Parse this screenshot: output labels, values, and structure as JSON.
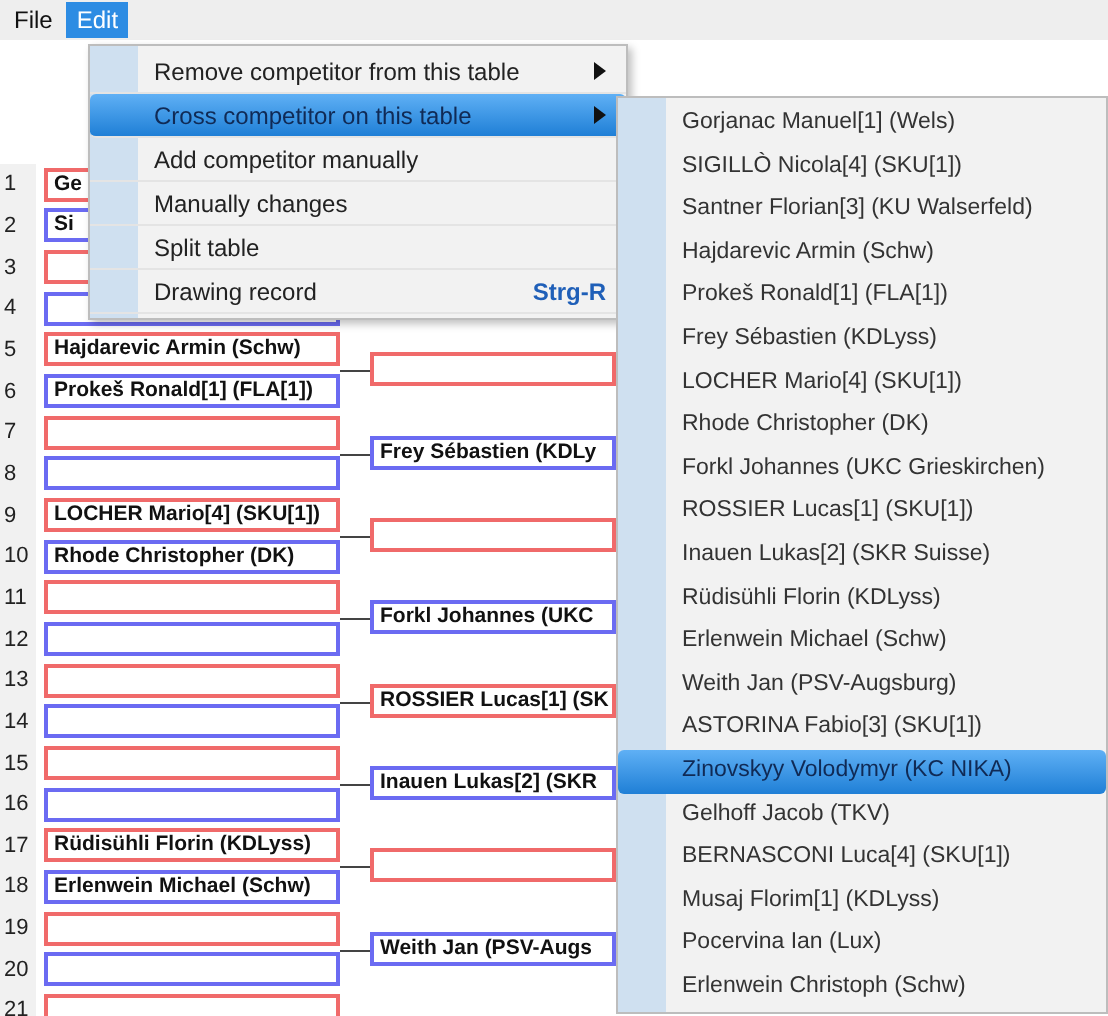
{
  "menu_bar": [
    {
      "label": "File",
      "selected": false
    },
    {
      "label": "Edit",
      "selected": true
    }
  ],
  "bracket": {
    "round_1": [
      {
        "number": "1",
        "name": "Ge"
      },
      {
        "number": "2",
        "name": "Si"
      },
      {
        "number": "3"
      },
      {
        "number": "4"
      },
      {
        "number": "5",
        "name": "Hajdarevic Armin (Schw)"
      },
      {
        "number": "6",
        "name": "Prokeš Ronald[1] (FLA[1])"
      },
      {
        "number": "7"
      },
      {
        "number": "8"
      },
      {
        "number": "9",
        "name": "LOCHER Mario[4] (SKU[1])"
      },
      {
        "number": "10",
        "name": "Rhode Christopher (DK)"
      },
      {
        "number": "11"
      },
      {
        "number": "12"
      },
      {
        "number": "13"
      },
      {
        "number": "14"
      },
      {
        "number": "15"
      },
      {
        "number": "16"
      },
      {
        "number": "17",
        "name": "Rüdisühli Florin (KDLyss)"
      },
      {
        "number": "18",
        "name": "Erlenwein Michael (Schw)"
      },
      {
        "number": "19"
      },
      {
        "number": "20"
      },
      {
        "number": "21"
      }
    ],
    "round_2": [
      {
        "color": "#f06a6a"
      },
      {
        "color": "#6b6bf2",
        "name": "Frey Sébastien (KDLy"
      },
      {
        "color": "#f06a6a"
      },
      {
        "color": "#6b6bf2",
        "name": "Forkl Johannes (UKC"
      },
      {
        "color": "#f06a6a",
        "name": "ROSSIER Lucas[1] (SK"
      },
      {
        "color": "#6b6bf2",
        "name": "Inauen Lukas[2] (SKR"
      },
      {
        "color": "#f06a6a"
      },
      {
        "color": "#6b6bf2",
        "name": "Weith Jan (PSV-Augs"
      }
    ]
  },
  "edit_menu": [
    {
      "label": "Remove competitor from this table",
      "submenu": true,
      "selected": false
    },
    {
      "label": "Cross competitor on this table",
      "submenu": true,
      "selected": true
    },
    {
      "label": "Add competitor manually",
      "submenu": false,
      "selected": false
    },
    {
      "label": "Manually changes",
      "submenu": false,
      "selected": false
    },
    {
      "label": "Split table",
      "submenu": false,
      "selected": false
    },
    {
      "label": "Drawing record",
      "submenu": false,
      "selected": false,
      "shortcut": "Strg-R"
    }
  ],
  "submenu": [
    {
      "label": "Gorjanac Manuel[1] (Wels)",
      "selected": false
    },
    {
      "label": "SIGILLÒ Nicola[4] (SKU[1])",
      "selected": false
    },
    {
      "label": "Santner Florian[3] (KU Walserfeld)",
      "selected": false
    },
    {
      "label": "Hajdarevic Armin (Schw)",
      "selected": false
    },
    {
      "label": "Prokeš Ronald[1] (FLA[1])",
      "selected": false
    },
    {
      "label": "Frey Sébastien (KDLyss)",
      "selected": false
    },
    {
      "label": "LOCHER Mario[4] (SKU[1])",
      "selected": false
    },
    {
      "label": "Rhode Christopher (DK)",
      "selected": false
    },
    {
      "label": "Forkl Johannes (UKC Grieskirchen)",
      "selected": false
    },
    {
      "label": "ROSSIER Lucas[1] (SKU[1])",
      "selected": false
    },
    {
      "label": "Inauen Lukas[2] (SKR Suisse)",
      "selected": false
    },
    {
      "label": "Rüdisühli Florin (KDLyss)",
      "selected": false
    },
    {
      "label": "Erlenwein Michael (Schw)",
      "selected": false
    },
    {
      "label": "Weith Jan (PSV-Augsburg)",
      "selected": false
    },
    {
      "label": "ASTORINA Fabio[3] (SKU[1])",
      "selected": false
    },
    {
      "label": "Zinovskyy Volodymyr (KC NIKA)",
      "selected": true
    },
    {
      "label": "Gelhoff Jacob (TKV)",
      "selected": false
    },
    {
      "label": "BERNASCONI Luca[4] (SKU[1])",
      "selected": false
    },
    {
      "label": "Musaj Florim[1] (KDLyss)",
      "selected": false
    },
    {
      "label": "Pocervina Ian (Lux)",
      "selected": false
    },
    {
      "label": "Erlenwein Christoph (Schw)",
      "selected": false
    }
  ]
}
